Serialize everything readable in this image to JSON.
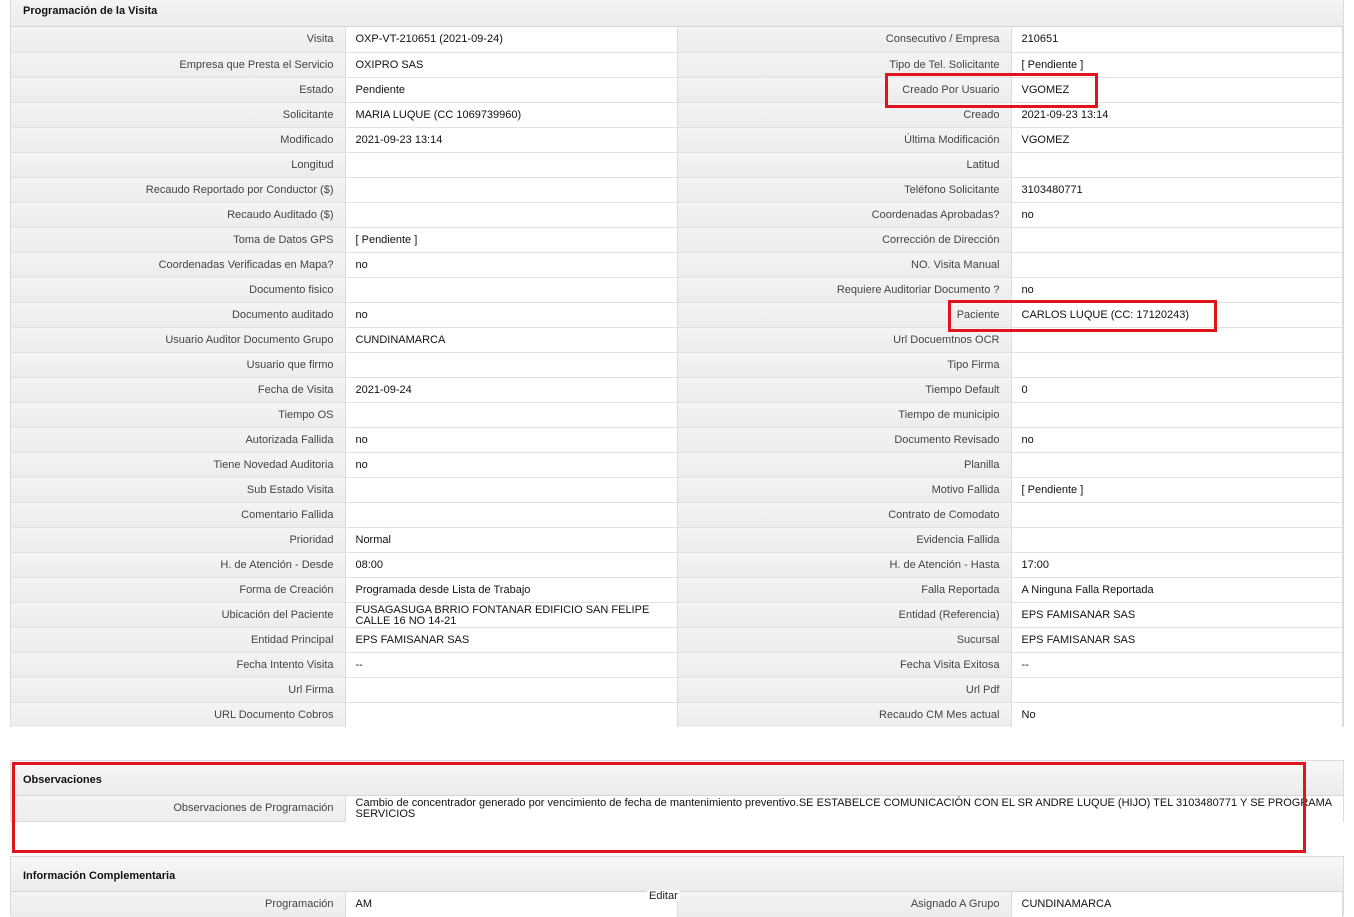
{
  "colors": {
    "highlight": "#e1141e",
    "header_bg": "#ececec",
    "label_bg": "#f0f0f0"
  },
  "programacion": {
    "title": "Programación de la Visita",
    "rows": [
      [
        {
          "label": "Visita",
          "value": "OXP-VT-210651 (2021-09-24)"
        },
        {
          "label": "Consecutivo / Empresa",
          "value": "210651"
        }
      ],
      [
        {
          "label": "Empresa que Presta el Servicio",
          "value": "OXIPRO SAS"
        },
        {
          "label": "Tipo de Tel. Solicitante",
          "value": "[ Pendiente ]"
        }
      ],
      [
        {
          "label": "Estado",
          "value": "Pendiente"
        },
        {
          "label": "Creado Por Usuario",
          "value": "VGOMEZ"
        }
      ],
      [
        {
          "label": "Solicitante",
          "value": "MARIA LUQUE (CC 1069739960)"
        },
        {
          "label": "Creado",
          "value": "2021-09-23 13:14"
        }
      ],
      [
        {
          "label": "Modificado",
          "value": "2021-09-23 13:14"
        },
        {
          "label": "Última Modificación",
          "value": " VGOMEZ"
        }
      ],
      [
        {
          "label": "Longitud",
          "value": ""
        },
        {
          "label": "Latitud",
          "value": ""
        }
      ],
      [
        {
          "label": "Recaudo Reportado por Conductor ($)",
          "value": ""
        },
        {
          "label": "Teléfono Solicitante",
          "value": "3103480771"
        }
      ],
      [
        {
          "label": "Recaudo Auditado ($)",
          "value": ""
        },
        {
          "label": "Coordenadas Aprobadas?",
          "value": " no"
        }
      ],
      [
        {
          "label": "Toma de Datos GPS",
          "value": "[ Pendiente ]"
        },
        {
          "label": "Corrección de Dirección",
          "value": ""
        }
      ],
      [
        {
          "label": "Coordenadas Verificadas en Mapa?",
          "value": " no"
        },
        {
          "label": "NO. Visita Manual",
          "value": ""
        }
      ],
      [
        {
          "label": "Documento fisico",
          "value": ""
        },
        {
          "label": "Requiere Auditoriar Documento ?",
          "value": " no"
        }
      ],
      [
        {
          "label": "Documento auditado",
          "value": " no"
        },
        {
          "label": "Paciente",
          "value": "CARLOS LUQUE (CC: 17120243)"
        }
      ],
      [
        {
          "label": "Usuario Auditor Documento Grupo",
          "value": "CUNDINAMARCA"
        },
        {
          "label": "Url Docuemtnos OCR",
          "value": ""
        }
      ],
      [
        {
          "label": "Usuario que firmo",
          "value": ""
        },
        {
          "label": "Tipo Firma",
          "value": ""
        }
      ],
      [
        {
          "label": "Fecha de Visita",
          "value": " 2021-09-24"
        },
        {
          "label": "Tiempo Default",
          "value": "0"
        }
      ],
      [
        {
          "label": "Tiempo OS",
          "value": ""
        },
        {
          "label": "Tiempo de municipio",
          "value": ""
        }
      ],
      [
        {
          "label": "Autorizada Fallida",
          "value": " no"
        },
        {
          "label": "Documento Revisado",
          "value": " no"
        }
      ],
      [
        {
          "label": "Tiene Novedad Auditoria",
          "value": " no"
        },
        {
          "label": "Planilla",
          "value": ""
        }
      ],
      [
        {
          "label": "Sub Estado Visita",
          "value": ""
        },
        {
          "label": "Motivo Fallida",
          "value": "[ Pendiente ]"
        }
      ],
      [
        {
          "label": "Comentario Fallida",
          "value": ""
        },
        {
          "label": "Contrato de Comodato",
          "value": ""
        }
      ],
      [
        {
          "label": "Prioridad",
          "value": "Normal"
        },
        {
          "label": "Evidencia Fallida",
          "value": ""
        }
      ],
      [
        {
          "label": "H. de Atención - Desde",
          "value": "08:00"
        },
        {
          "label": "H. de Atención - Hasta",
          "value": "17:00"
        }
      ],
      [
        {
          "label": "Forma de Creación",
          "value": "Programada desde Lista de Trabajo"
        },
        {
          "label": "Falla Reportada",
          "value": "A Ninguna Falla Reportada"
        }
      ],
      [
        {
          "label": "Ubicación del Paciente",
          "value": "FUSAGASUGA BRRIO FONTANAR EDIFICIO SAN FELIPE CALLE 16 NO 14-21"
        },
        {
          "label": "Entidad (Referencia)",
          "value": "EPS FAMISANAR SAS"
        }
      ],
      [
        {
          "label": "Entidad Principal",
          "value": "EPS FAMISANAR SAS"
        },
        {
          "label": "Sucursal",
          "value": "EPS FAMISANAR SAS"
        }
      ],
      [
        {
          "label": "Fecha Intento Visita",
          "value": "--"
        },
        {
          "label": "Fecha Visita Exitosa",
          "value": "--"
        }
      ],
      [
        {
          "label": "Url Firma",
          "value": ""
        },
        {
          "label": "Url Pdf",
          "value": ""
        }
      ],
      [
        {
          "label": "URL Documento Cobros",
          "value": ""
        },
        {
          "label": "Recaudo CM Mes actual",
          "value": "No"
        }
      ]
    ]
  },
  "observaciones": {
    "title": "Observaciones",
    "label": "Observaciones de Programación",
    "value": "  Cambio de concentrador generado por vencimiento de fecha de mantenimiento preventivo.SE ESTABELCE COMUNICACIÓN CON EL SR ANDRE LUQUE (HIJO) TEL 3103480771 Y SE PROGRAMA SERVICIOS"
  },
  "complementaria": {
    "title": "Información Complementaria",
    "row": [
      {
        "label": "Programación",
        "value": "AM"
      },
      {
        "label": "Asignado A Grupo",
        "value": "CUNDINAMARCA"
      }
    ],
    "edit_label": "Editar"
  }
}
